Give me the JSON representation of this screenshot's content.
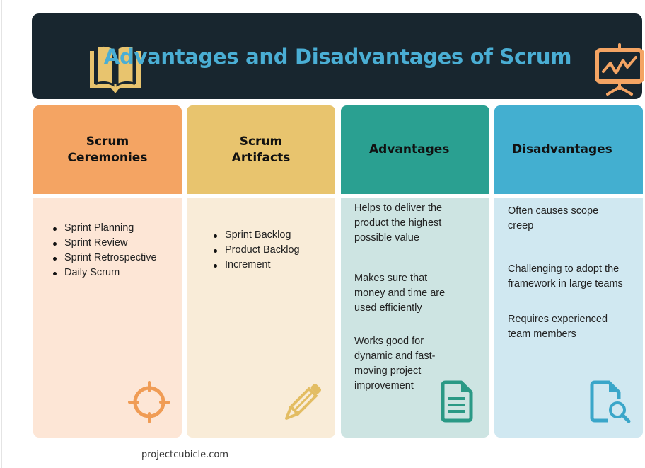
{
  "header": {
    "title": "Advantages and Disadvantages of Scrum",
    "left_icon": "open-book-icon",
    "right_icon": "presentation-chart-icon"
  },
  "columns": [
    {
      "title_line1": "Scrum",
      "title_line2": "Ceremonies",
      "items": [
        "Sprint Planning",
        "Sprint Review",
        "Sprint Retrospective",
        "Daily Scrum"
      ],
      "icon": "crosshair-target-icon",
      "header_color": "#f4a463",
      "body_color": "#fde6d6"
    },
    {
      "title_line1": "Scrum",
      "title_line2": "Artifacts",
      "items": [
        "Sprint Backlog",
        "Product Backlog",
        "Increment"
      ],
      "icon": "pencil-icon",
      "header_color": "#e8c46e",
      "body_color": "#f9ecd8"
    },
    {
      "title": "Advantages",
      "paragraphs": [
        "Helps to deliver the product the highest possible value",
        "Makes sure that money and time are used efficiently",
        "Works good for dynamic and fast-moving project improvement"
      ],
      "icon": "document-icon",
      "header_color": "#2aa091",
      "body_color": "#cde4e2"
    },
    {
      "title": "Disadvantages",
      "paragraphs": [
        "Often causes scope creep",
        "Challenging to adopt the framework in large teams",
        "Requires experienced team members"
      ],
      "icon": "document-search-icon",
      "header_color": "#43afd0",
      "body_color": "#d0e8f1"
    }
  ],
  "footer": {
    "text": "projectcubicle.com"
  }
}
